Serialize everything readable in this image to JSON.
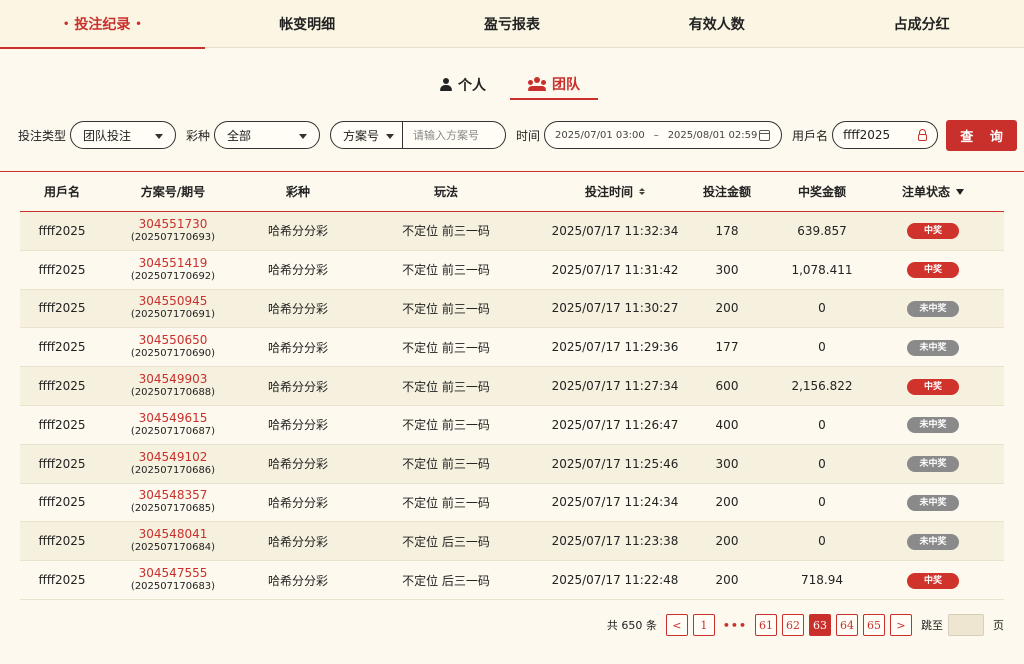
{
  "top_tabs": [
    {
      "label": "投注纪录",
      "active": true
    },
    {
      "label": "帐变明细",
      "active": false
    },
    {
      "label": "盈亏报表",
      "active": false
    },
    {
      "label": "有效人数",
      "active": false
    },
    {
      "label": "占成分红",
      "active": false
    }
  ],
  "top_tab_dot": "•",
  "sub_tabs": [
    {
      "label": "个人",
      "icon": "person-icon",
      "active": false
    },
    {
      "label": "团队",
      "icon": "team-icon",
      "active": true
    }
  ],
  "filters": {
    "bet_type_label": "投注类型",
    "bet_type_value": "团队投注",
    "lottery_label": "彩种",
    "lottery_value": "全部",
    "plan_select": "方案号",
    "plan_placeholder": "请输入方案号",
    "time_label": "时间",
    "date_start": "2025/07/01 03:00",
    "date_sep": "–",
    "date_end": "2025/08/01 02:59",
    "user_label": "用戶名",
    "user_value": "ffff2025",
    "query_button": "查 询"
  },
  "table": {
    "headers": [
      "用戶名",
      "方案号/期号",
      "彩种",
      "玩法",
      "投注时间",
      "投注金额",
      "中奖金额",
      "注单状态"
    ],
    "rows": [
      {
        "user": "ffff2025",
        "plan": "304551730",
        "period": "(202507170693)",
        "lottery": "哈希分分彩",
        "play": "不定位 前三一码",
        "time": "2025/07/17 11:32:34",
        "bet": "178",
        "win": "639.857",
        "status": "中奖",
        "won": true
      },
      {
        "user": "ffff2025",
        "plan": "304551419",
        "period": "(202507170692)",
        "lottery": "哈希分分彩",
        "play": "不定位 前三一码",
        "time": "2025/07/17 11:31:42",
        "bet": "300",
        "win": "1,078.411",
        "status": "中奖",
        "won": true
      },
      {
        "user": "ffff2025",
        "plan": "304550945",
        "period": "(202507170691)",
        "lottery": "哈希分分彩",
        "play": "不定位 前三一码",
        "time": "2025/07/17 11:30:27",
        "bet": "200",
        "win": "0",
        "status": "未中奖",
        "won": false
      },
      {
        "user": "ffff2025",
        "plan": "304550650",
        "period": "(202507170690)",
        "lottery": "哈希分分彩",
        "play": "不定位 前三一码",
        "time": "2025/07/17 11:29:36",
        "bet": "177",
        "win": "0",
        "status": "未中奖",
        "won": false
      },
      {
        "user": "ffff2025",
        "plan": "304549903",
        "period": "(202507170688)",
        "lottery": "哈希分分彩",
        "play": "不定位 前三一码",
        "time": "2025/07/17 11:27:34",
        "bet": "600",
        "win": "2,156.822",
        "status": "中奖",
        "won": true
      },
      {
        "user": "ffff2025",
        "plan": "304549615",
        "period": "(202507170687)",
        "lottery": "哈希分分彩",
        "play": "不定位 前三一码",
        "time": "2025/07/17 11:26:47",
        "bet": "400",
        "win": "0",
        "status": "未中奖",
        "won": false
      },
      {
        "user": "ffff2025",
        "plan": "304549102",
        "period": "(202507170686)",
        "lottery": "哈希分分彩",
        "play": "不定位 前三一码",
        "time": "2025/07/17 11:25:46",
        "bet": "300",
        "win": "0",
        "status": "未中奖",
        "won": false
      },
      {
        "user": "ffff2025",
        "plan": "304548357",
        "period": "(202507170685)",
        "lottery": "哈希分分彩",
        "play": "不定位 前三一码",
        "time": "2025/07/17 11:24:34",
        "bet": "200",
        "win": "0",
        "status": "未中奖",
        "won": false
      },
      {
        "user": "ffff2025",
        "plan": "304548041",
        "period": "(202507170684)",
        "lottery": "哈希分分彩",
        "play": "不定位 后三一码",
        "time": "2025/07/17 11:23:38",
        "bet": "200",
        "win": "0",
        "status": "未中奖",
        "won": false
      },
      {
        "user": "ffff2025",
        "plan": "304547555",
        "period": "(202507170683)",
        "lottery": "哈希分分彩",
        "play": "不定位 后三一码",
        "time": "2025/07/17 11:22:48",
        "bet": "200",
        "win": "718.94",
        "status": "中奖",
        "won": true
      }
    ]
  },
  "pagination": {
    "total": "共 650 条",
    "prev": "<",
    "next": ">",
    "first": "1",
    "ellipsis": "•••",
    "pages": [
      "61",
      "62",
      "63",
      "64",
      "65"
    ],
    "current": "63",
    "jump_label": "跳至",
    "page_suffix": "页"
  },
  "colors": {
    "accent": "#c9302c",
    "win_badge": "#d0322c",
    "lose_badge": "#8a8a8a",
    "background": "#fdf9ee"
  }
}
